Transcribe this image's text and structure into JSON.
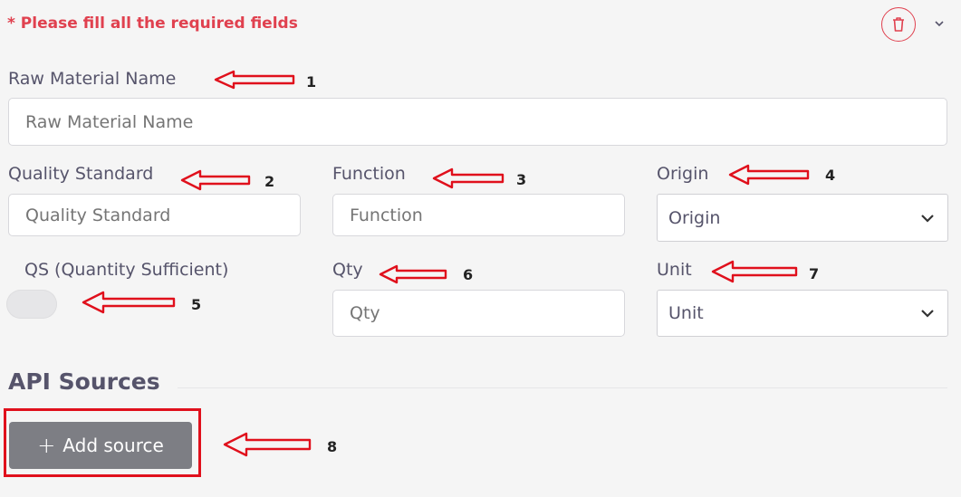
{
  "form": {
    "required_note": "* Please fill all the required fields",
    "fields": {
      "raw_material_name": {
        "label": "Raw Material Name",
        "placeholder": "Raw Material Name"
      },
      "quality_standard": {
        "label": "Quality Standard",
        "placeholder": "Quality Standard"
      },
      "function": {
        "label": "Function",
        "placeholder": "Function"
      },
      "origin": {
        "label": "Origin",
        "selected": "Origin"
      },
      "qs": {
        "label": "QS (Quantity Sufficient)"
      },
      "qty": {
        "label": "Qty",
        "placeholder": "Qty"
      },
      "unit": {
        "label": "Unit",
        "selected": "Unit"
      }
    }
  },
  "api_sources": {
    "title": "API Sources",
    "add_button_icon": "+",
    "add_button_label": "Add source"
  },
  "annotations": [
    "1",
    "2",
    "3",
    "4",
    "5",
    "6",
    "7",
    "8"
  ],
  "icons": [
    "trash-icon",
    "chevron-down-icon"
  ],
  "colors": {
    "accent_red": "#e0414f",
    "annotation_red": "#e0101c",
    "button_gray": "#7d7e84"
  }
}
